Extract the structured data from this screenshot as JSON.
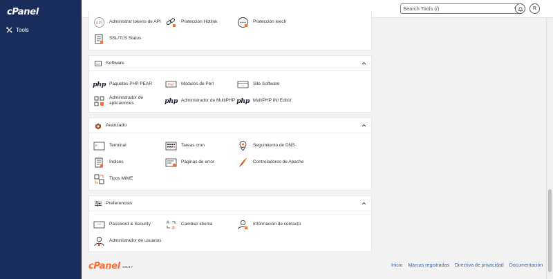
{
  "sidebar": {
    "logo": "cPanel",
    "tools_label": "Tools"
  },
  "header": {
    "search_placeholder": "Search Tools (/)",
    "user_initial": "R"
  },
  "top_items": {
    "api_tokens": "Administrar tokens de API",
    "hotlink": "Protección Hotlink",
    "leech": "Protección leech",
    "ssl_status": "SSL/TLS Status"
  },
  "software": {
    "title": "Software",
    "items": {
      "pear": "Paquetes PHP PEAR",
      "perl": "Módulos de Perl",
      "site_software": "Site Software",
      "apps": "Administrador de aplicaciones",
      "multiphp": "Administrador de MultiPHP",
      "multiphp_ini": "MultiPHP INI Editor"
    }
  },
  "avanzado": {
    "title": "Avanzado",
    "items": {
      "terminal": "Terminal",
      "cron": "Tareas cron",
      "dns": "Seguimiento de DNS",
      "indices": "Índices",
      "error_pages": "Páginas de error",
      "apache": "Controladores de Apache",
      "mime": "Tipos MIME"
    }
  },
  "preferencias": {
    "title": "Preferencias",
    "items": {
      "password": "Password & Security",
      "language": "Cambiar idioma",
      "contact": "Información de contacto",
      "users": "Administrador de usuarios"
    }
  },
  "footer": {
    "logo": "cPanel",
    "version": "106.9.7",
    "links": [
      "Inicio",
      "Marcas registradas",
      "Directiva de privacidad",
      "Documentación"
    ]
  },
  "icon_names": {
    "api": "api-icon",
    "hotlink": "hotlink-chain-icon",
    "leech": "leech-dots-icon",
    "ssl": "ssl-document-icon",
    "perl": "perl-box-icon",
    "site": "site-software-icon",
    "apps": "apps-grid-icon",
    "php": "php-logo-icon",
    "terminal": "terminal-icon",
    "cron": "calendar-cron-icon",
    "dns": "dns-pin-icon",
    "indices": "index-list-icon",
    "errors": "error-page-icon",
    "apache": "apache-feather-icon",
    "mime": "mime-types-icon",
    "password": "password-field-icon",
    "language": "language-icon",
    "contact": "contact-person-icon",
    "users": "user-manager-icon"
  },
  "colors": {
    "sidebar": "#192c5b",
    "accent": "#ff6c2c",
    "link": "#3a5fa5",
    "page_bg": "#f3f3f4"
  }
}
